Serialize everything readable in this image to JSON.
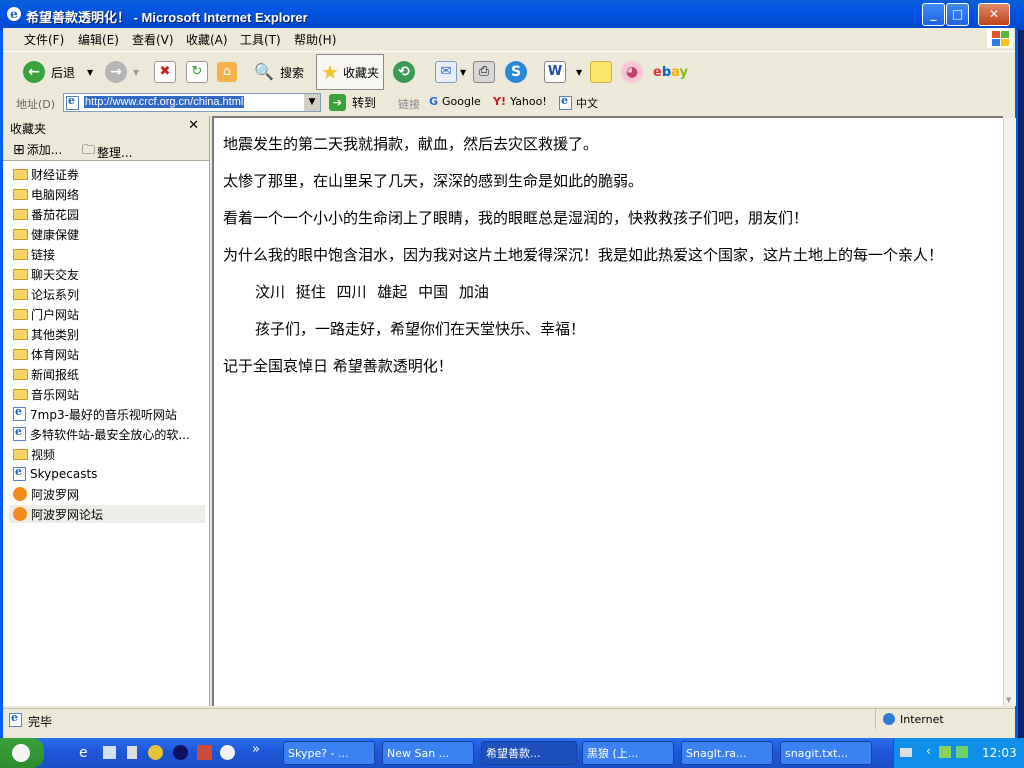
{
  "window": {
    "title": "希望善款透明化！ - Microsoft Internet Explorer",
    "min": "_",
    "max": "□",
    "close": "✕"
  },
  "menu": [
    "文件(F)",
    "编辑(E)",
    "查看(V)",
    "收藏(A)",
    "工具(T)",
    "帮助(H)"
  ],
  "toolbar": {
    "back": "后退",
    "search": "搜索",
    "favorites": "收藏夹"
  },
  "address": {
    "label": "地址(D)",
    "url": "http://www.crcf.org.cn/china.html",
    "go": "转到",
    "links_label": "链接",
    "links": [
      "Google",
      "Yahoo!",
      "中文"
    ]
  },
  "sidebar": {
    "title": "收藏夹",
    "add": "添加...",
    "organize": "整理...",
    "items": [
      {
        "label": "财经证券",
        "icon": "folder-icon"
      },
      {
        "label": "电脑网络",
        "icon": "folder-icon"
      },
      {
        "label": "番茄花园",
        "icon": "folder-icon"
      },
      {
        "label": "健康保健",
        "icon": "folder-icon"
      },
      {
        "label": "链接",
        "icon": "folder-icon"
      },
      {
        "label": "聊天交友",
        "icon": "folder-icon"
      },
      {
        "label": "论坛系列",
        "icon": "folder-icon"
      },
      {
        "label": "门户网站",
        "icon": "folder-icon"
      },
      {
        "label": "其他类别",
        "icon": "folder-icon"
      },
      {
        "label": "体育网站",
        "icon": "folder-icon"
      },
      {
        "label": "新闻报纸",
        "icon": "folder-icon"
      },
      {
        "label": "音乐网站",
        "icon": "folder-icon"
      },
      {
        "label": "7mp3-最好的音乐视听网站",
        "icon": "ie-page-icon"
      },
      {
        "label": "多特软件站-最安全放心的软...",
        "icon": "ie-page-icon"
      },
      {
        "label": "视频",
        "icon": "folder-icon"
      },
      {
        "label": "Skypecasts",
        "icon": "ie-page-icon"
      },
      {
        "label": "阿波罗网",
        "icon": "apollo-icon"
      },
      {
        "label": "阿波罗网论坛",
        "icon": "apollo-icon"
      }
    ]
  },
  "content": {
    "paragraphs": [
      "地震发生的第二天我就捐款，献血，然后去灾区救援了。",
      "太惨了那里，在山里呆了几天，深深的感到生命是如此的脆弱。",
      "看着一个一个小小的生命闭上了眼睛，我的眼眶总是湿润的，快救救孩子们吧，朋友们！",
      "为什么我的眼中饱含泪水，因为我对这片土地爱得深沉！我是如此热爱这个国家，这片土地上的每一个亲人！",
      "汶川 挺住 四川 雄起 中国 加油",
      "孩子们，一路走好，希望你们在天堂快乐、幸福！",
      "记于全国哀悼日 希望善款透明化！"
    ]
  },
  "status": {
    "text": "完毕",
    "zone": "Internet"
  },
  "taskbar": {
    "tasks": [
      "Skype? - ...",
      "New San ...",
      "希望善款...",
      "黑狼 (上...",
      "SnagIt.ra...",
      "snagit.txt..."
    ],
    "clock": "12:03"
  }
}
